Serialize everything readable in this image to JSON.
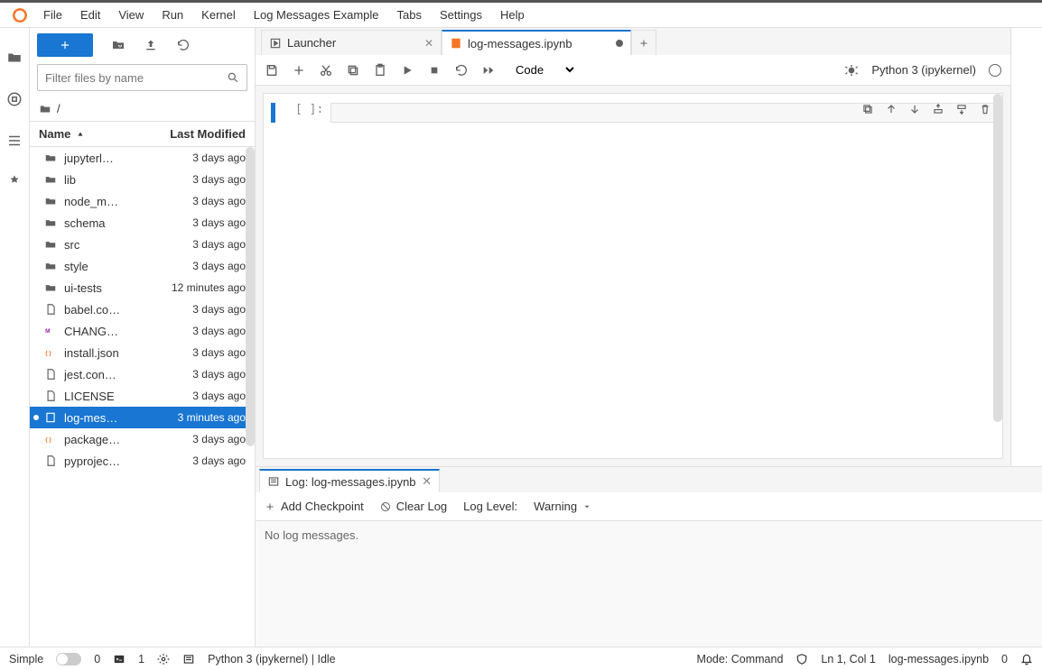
{
  "menubar": {
    "items": [
      "File",
      "Edit",
      "View",
      "Run",
      "Kernel",
      "Log Messages Example",
      "Tabs",
      "Settings",
      "Help"
    ]
  },
  "sidebar": {
    "filter_placeholder": "Filter files by name",
    "breadcrumb": "/",
    "columns": {
      "name": "Name",
      "modified": "Last Modified"
    },
    "files": [
      {
        "icon": "folder",
        "name": "jupyterl…",
        "modified": "3 days ago"
      },
      {
        "icon": "folder",
        "name": "lib",
        "modified": "3 days ago"
      },
      {
        "icon": "folder",
        "name": "node_m…",
        "modified": "3 days ago"
      },
      {
        "icon": "folder",
        "name": "schema",
        "modified": "3 days ago"
      },
      {
        "icon": "folder",
        "name": "src",
        "modified": "3 days ago"
      },
      {
        "icon": "folder",
        "name": "style",
        "modified": "3 days ago"
      },
      {
        "icon": "folder",
        "name": "ui-tests",
        "modified": "12 minutes ago"
      },
      {
        "icon": "file",
        "name": "babel.co…",
        "modified": "3 days ago"
      },
      {
        "icon": "markdown",
        "name": "CHANG…",
        "modified": "3 days ago"
      },
      {
        "icon": "json",
        "name": "install.json",
        "modified": "3 days ago"
      },
      {
        "icon": "file",
        "name": "jest.con…",
        "modified": "3 days ago"
      },
      {
        "icon": "file",
        "name": "LICENSE",
        "modified": "3 days ago"
      },
      {
        "icon": "notebook",
        "name": "log-mes…",
        "modified": "3 minutes ago",
        "selected": true,
        "running": true
      },
      {
        "icon": "json",
        "name": "package…",
        "modified": "3 days ago"
      },
      {
        "icon": "file",
        "name": "pyprojec…",
        "modified": "3 days ago"
      }
    ]
  },
  "tabs": [
    {
      "icon": "launcher",
      "label": "Launcher",
      "closable": true
    },
    {
      "icon": "notebook",
      "label": "log-messages.ipynb",
      "dirty": true,
      "active": true
    }
  ],
  "nb_toolbar": {
    "cell_type": "Code",
    "kernel": "Python 3 (ipykernel)"
  },
  "cell": {
    "prompt": "[ ]:"
  },
  "log": {
    "tab_label": "Log: log-messages.ipynb",
    "add_checkpoint": "Add Checkpoint",
    "clear_log": "Clear Log",
    "log_level_label": "Log Level:",
    "log_level_value": "Warning",
    "empty": "No log messages."
  },
  "status": {
    "simple": "Simple",
    "terminals": "0",
    "kernels": "1",
    "kernel": "Python 3 (ipykernel) | Idle",
    "mode": "Mode: Command",
    "position": "Ln 1, Col 1",
    "file": "log-messages.ipynb",
    "zero": "0"
  }
}
